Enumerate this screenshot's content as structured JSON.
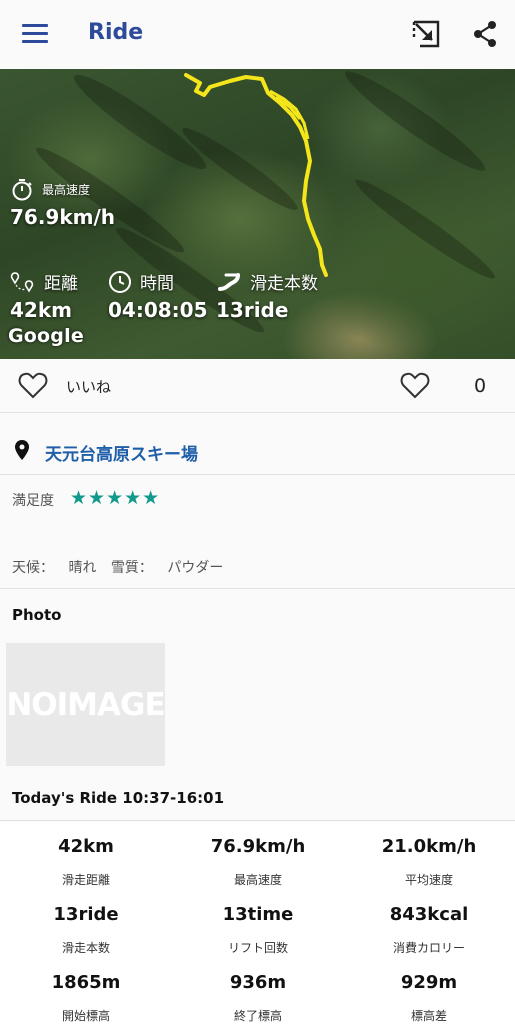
{
  "appbar": {
    "title": "Ride",
    "menu_icon": "menu-icon",
    "cast_icon": "cast-icon",
    "share_icon": "share-icon",
    "accent": "#2e4a9a"
  },
  "map": {
    "max_speed_label": "最高速度",
    "max_speed_value": "76.9km/h",
    "distance_label": "距離",
    "distance_value": "42km",
    "time_label": "時間",
    "time_value": "04:08:05",
    "runs_label": "滑走本数",
    "runs_value": "13ride",
    "attribution": "Google",
    "track_color": "#f5e61c"
  },
  "like": {
    "label": "いいね",
    "count": "0"
  },
  "location": {
    "name": "天元台高原スキー場",
    "color": "#1f5ea8"
  },
  "details": {
    "satisfaction_label": "満足度",
    "stars": "★★★★★",
    "stars_color": "#119a8c",
    "weather_label": "天候：",
    "weather_value": "晴れ",
    "snow_label": "雪質：",
    "snow_value": "パウダー"
  },
  "photo": {
    "title": "Photo",
    "placeholder": "NOIMAGE",
    "ride_summary": "Today's Ride 10:37-16:01"
  },
  "stats": [
    {
      "value": "42km",
      "label": "滑走距離"
    },
    {
      "value": "76.9km/h",
      "label": "最高速度"
    },
    {
      "value": "21.0km/h",
      "label": "平均速度"
    },
    {
      "value": "13ride",
      "label": "滑走本数"
    },
    {
      "value": "13time",
      "label": "リフト回数"
    },
    {
      "value": "843kcal",
      "label": "消費カロリー"
    },
    {
      "value": "1865m",
      "label": "開始標高"
    },
    {
      "value": "936m",
      "label": "終了標高"
    },
    {
      "value": "929m",
      "label": "標高差"
    }
  ]
}
